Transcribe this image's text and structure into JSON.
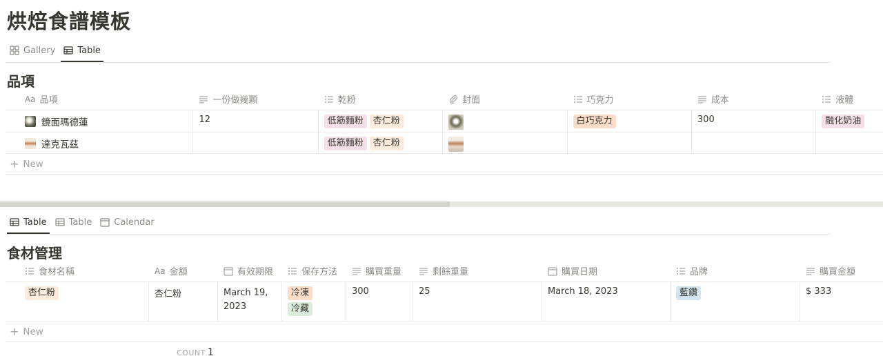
{
  "page": {
    "title": "烘焙食譜模板"
  },
  "top_tabs": [
    {
      "label": "Gallery",
      "icon": "gallery-icon"
    },
    {
      "label": "Table",
      "icon": "table-icon"
    }
  ],
  "recipes": {
    "title": "品項",
    "columns": [
      {
        "label": "品項",
        "icon": "title-aa-icon"
      },
      {
        "label": "一份做幾顆",
        "icon": "text-icon"
      },
      {
        "label": "乾粉",
        "icon": "multiselect-icon"
      },
      {
        "label": "封面",
        "icon": "attachment-icon"
      },
      {
        "label": "巧克力",
        "icon": "multiselect-icon"
      },
      {
        "label": "成本",
        "icon": "text-icon"
      },
      {
        "label": "液體",
        "icon": "multiselect-icon"
      }
    ],
    "rows": [
      {
        "name": "鏡面瑪德蓮",
        "per_batch": "12",
        "flour": [
          "低筋麵粉",
          "杏仁粉"
        ],
        "chocolate": [
          "白巧克力"
        ],
        "cost": "300",
        "liquid": [
          "融化奶油"
        ]
      },
      {
        "name": "達克瓦茲",
        "per_batch": "",
        "flour": [
          "低筋麵粉",
          "杏仁粉"
        ],
        "chocolate": [],
        "cost": "",
        "liquid": []
      }
    ],
    "new_label": "New"
  },
  "bottom_tabs": [
    {
      "label": "Table",
      "icon": "table-icon"
    },
    {
      "label": "Table",
      "icon": "table-icon"
    },
    {
      "label": "Calendar",
      "icon": "calendar-icon"
    }
  ],
  "ingredients": {
    "title": "食材管理",
    "columns": [
      {
        "label": "食材名稱",
        "icon": "multiselect-icon"
      },
      {
        "label": "金額",
        "icon": "title-aa-icon"
      },
      {
        "label": "有效期限",
        "icon": "calendar-icon"
      },
      {
        "label": "保存方法",
        "icon": "multiselect-icon"
      },
      {
        "label": "購買重量",
        "icon": "text-icon"
      },
      {
        "label": "剩餘重量",
        "icon": "text-icon"
      },
      {
        "label": "購買日期",
        "icon": "calendar-icon"
      },
      {
        "label": "品牌",
        "icon": "multiselect-icon"
      },
      {
        "label": "購買金額",
        "icon": "text-icon"
      }
    ],
    "rows": [
      {
        "ingredient": "杏仁粉",
        "amount": "杏仁粉",
        "expiry_line1": "March 19,",
        "expiry_line2": "2023",
        "storage": [
          "冷凍",
          "冷藏"
        ],
        "purchase_weight": "300",
        "remaining_weight": "25",
        "purchase_date": "March 18, 2023",
        "brand": "藍鑽",
        "purchase_amount": "$ 333"
      }
    ],
    "new_label": "New",
    "count_label": "COUNT",
    "count_value": "1"
  },
  "colors": {
    "tag_pink": "#f5e0e9",
    "tag_yellow": "#fbecdd",
    "tag_orange": "#fadec9",
    "tag_green": "#dbeddb",
    "tag_blue": "#d3e5ef",
    "scroll_track": "#ebe9e4",
    "scroll_thumb": "#d5d3ce"
  }
}
